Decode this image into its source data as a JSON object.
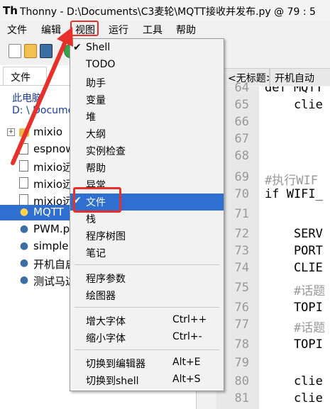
{
  "window": {
    "app_icon": "Th",
    "title": "Thonny  -  D:\\Documents\\C3麦轮\\MQTT接收并发布.py  @  79 : 5"
  },
  "menubar": {
    "items": [
      "文件",
      "编辑",
      "视图",
      "运行",
      "工具",
      "帮助"
    ]
  },
  "files_pane": {
    "tab_label": "文件",
    "pc_label": "此电脑",
    "path_label": "D: \\ Documents",
    "rows": [
      {
        "name": "mixio",
        "type": "folder"
      },
      {
        "name": "espnow",
        "type": "file"
      },
      {
        "name": "mixio远",
        "type": "file"
      },
      {
        "name": "mixio远",
        "type": "file"
      },
      {
        "name": "mixio远",
        "type": "file"
      },
      {
        "name": "MQTT",
        "type": "python"
      },
      {
        "name": "PWM.py",
        "type": "python"
      },
      {
        "name": "simple",
        "type": "python"
      },
      {
        "name": "开机自启",
        "type": "python"
      },
      {
        "name": "测试马达",
        "type": "python"
      }
    ]
  },
  "editor": {
    "tabs": [
      "<无标题>",
      "开机自动"
    ],
    "line_numbers": [
      "64",
      "65",
      "66",
      "67",
      "68",
      "69",
      "70",
      "71",
      "72",
      "73",
      "74",
      "75",
      "76",
      "77",
      "78",
      "79",
      "80",
      "81"
    ],
    "lines": [
      "def MQTT",
      "    clie",
      "",
      "",
      "",
      "#执行WIF",
      "if WIFI_",
      "",
      "    SERV",
      "    PORT",
      "    CLIE",
      "    #话题",
      "    TOPI",
      "    #话题",
      "    TOPI",
      "",
      "    clie",
      "    clie"
    ]
  },
  "view_menu": {
    "items": [
      {
        "label": "Shell",
        "checked": true
      },
      {
        "label": "TODO",
        "checked": false
      },
      {
        "label": "助手",
        "checked": false
      },
      {
        "label": "变量",
        "checked": false
      },
      {
        "label": "堆",
        "checked": false
      },
      {
        "label": "大纲",
        "checked": false
      },
      {
        "label": "实例检查",
        "checked": false
      },
      {
        "label": "帮助",
        "checked": false
      },
      {
        "label": "异常",
        "checked": false
      },
      {
        "label": "文件",
        "checked": true,
        "selected": true
      },
      {
        "label": "栈",
        "checked": false
      },
      {
        "label": "程序树图",
        "checked": false
      },
      {
        "label": "笔记",
        "checked": false
      }
    ],
    "group2": [
      {
        "label": "程序参数"
      },
      {
        "label": "绘图器"
      }
    ],
    "group3": [
      {
        "label": "增大字体",
        "shortcut": "Ctrl++"
      },
      {
        "label": "缩小字体",
        "shortcut": "Ctrl+-"
      }
    ],
    "group4": [
      {
        "label": "切换到编辑器",
        "shortcut": "Alt+E"
      },
      {
        "label": "切换到shell",
        "shortcut": "Alt+S"
      }
    ]
  },
  "colors": {
    "selection": "#2e6fd0",
    "annotation": "#e8302a"
  }
}
